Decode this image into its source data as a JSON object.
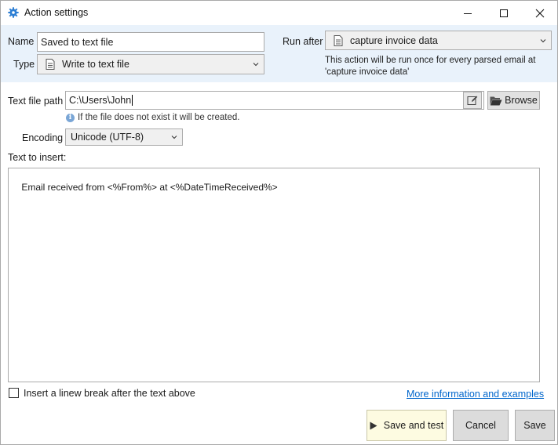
{
  "window": {
    "title": "Action settings",
    "icon": "gear-icon"
  },
  "name_field": {
    "label": "Name",
    "value": "Saved to text file"
  },
  "type_field": {
    "label": "Type",
    "value": "Write to text file",
    "icon": "document-icon"
  },
  "run_after": {
    "label": "Run after",
    "value": "capture invoice data",
    "icon": "document-icon",
    "note_line1": "This action will be run once for every parsed email at",
    "note_line2": "'capture invoice data'"
  },
  "text_file_path": {
    "label": "Text file path",
    "value": "C:\\Users\\John",
    "browse_label": "Browse",
    "hint": "If the file does not exist it will be created."
  },
  "encoding": {
    "label": "Encoding",
    "value": "Unicode (UTF-8)"
  },
  "text_to_insert": {
    "label": "Text to insert:",
    "value": "Email received from <%From%> at <%DateTimeReceived%>"
  },
  "linebreak_checkbox": {
    "label": "Insert a linew break after the text above",
    "checked": false
  },
  "more_info_link": "More information and examples",
  "buttons": {
    "save_and_test": "Save and test",
    "cancel": "Cancel",
    "save": "Save"
  },
  "colors": {
    "header_bg": "#e9f2fb",
    "link": "#0066cc",
    "save_test_bg": "#fdfbe1"
  }
}
